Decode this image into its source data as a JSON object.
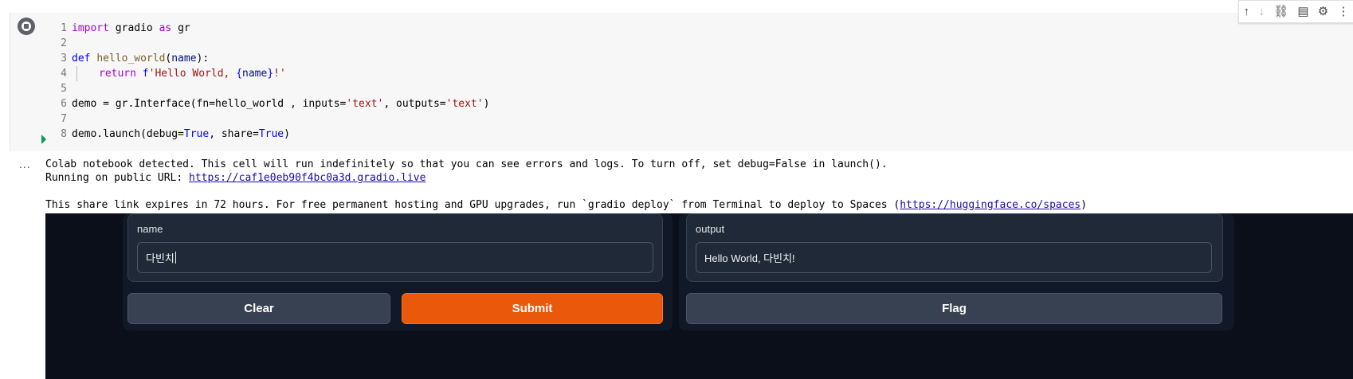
{
  "toolbar": {
    "icons": [
      "arrow-up-icon",
      "arrow-down-icon",
      "link-icon",
      "comment-icon",
      "gear-icon",
      "more-icon"
    ]
  },
  "code": {
    "line_numbers": [
      "1",
      "2",
      "3",
      "4",
      "5",
      "6",
      "7",
      "8"
    ],
    "l1_import": "import",
    "l1_module": "gradio",
    "l1_as": "as",
    "l1_alias": "gr",
    "l3_def": "def",
    "l3_fname": "hello_world",
    "l3_open": "(",
    "l3_param": "name",
    "l3_close": "):",
    "l4_return": "return",
    "l4_f": "f",
    "l4_str1": "'Hello World, ",
    "l4_brace_open": "{",
    "l4_name": "name",
    "l4_brace_close": "}",
    "l4_str2": "!'",
    "l6_demo": "demo = gr.Interface(",
    "l6_fn": "fn=hello_world , inputs=",
    "l6_text1": "'text'",
    "l6_mid": ", outputs=",
    "l6_text2": "'text'",
    "l6_end": ")",
    "l8_start": "demo.launch(",
    "l8_debug": "debug=",
    "l8_true1": "True",
    "l8_share": ", share=",
    "l8_true2": "True",
    "l8_end": ")"
  },
  "output": {
    "ellipsis": "...",
    "line1": "Colab notebook detected. This cell will run indefinitely so that you can see errors and logs. To turn off, set debug=False in launch().",
    "line2_prefix": "Running on public URL: ",
    "line2_link": "https://caf1e0eb90f4bc0a3d.gradio.live",
    "line4_prefix": "This share link expires in 72 hours. For free permanent hosting and GPU upgrades, run `gradio deploy` from Terminal to deploy to Spaces (",
    "line4_link": "https://huggingface.co/spaces",
    "line4_suffix": ")"
  },
  "gradio": {
    "input_label": "name",
    "input_value": "다빈치",
    "output_label": "output",
    "output_value": "Hello World, 다빈치!",
    "clear_label": "Clear",
    "submit_label": "Submit",
    "flag_label": "Flag",
    "colors": {
      "background": "#0b0f19",
      "panel": "#1f2937",
      "primary": "#ea580c",
      "secondary": "#374151"
    }
  }
}
